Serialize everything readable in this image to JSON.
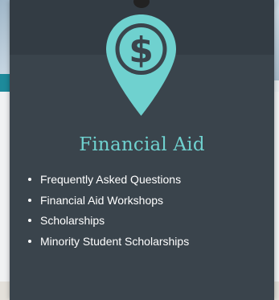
{
  "card": {
    "title": "Financial Aid",
    "icon": "dollar-map-pin-icon",
    "links": [
      {
        "label": "Frequently Asked Questions"
      },
      {
        "label": "Financial Aid Workshops"
      },
      {
        "label": "Scholarships"
      },
      {
        "label": "Minority Student Scholarships"
      }
    ]
  },
  "colors": {
    "card_bg": "#3a444c",
    "accent": "#6fd1cf",
    "link_text": "#ffffff"
  }
}
